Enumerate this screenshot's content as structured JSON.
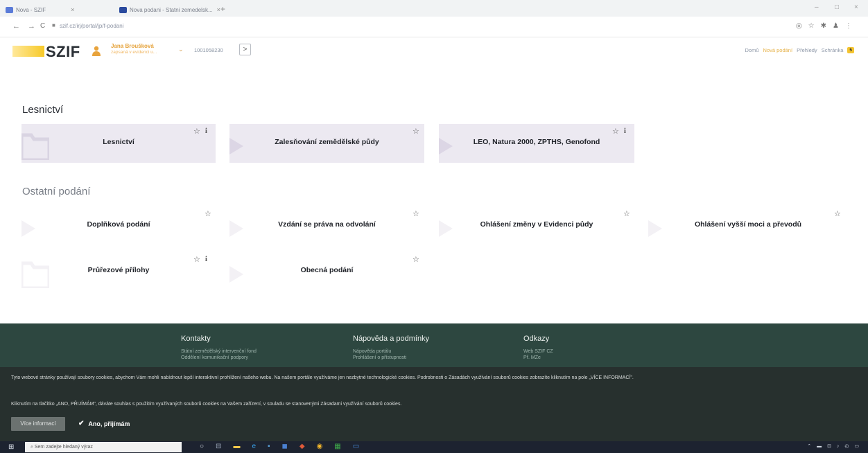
{
  "browser": {
    "tabs": [
      {
        "title": "Nova - SZIF",
        "icon_color": "#5a7bd8"
      },
      {
        "title": "Nova podani - Statni zemedelsk...",
        "icon_color": "#2a4a9e"
      }
    ],
    "new_tab": "+",
    "url": "szif.cz/irj/portal/jp/f-podani",
    "window_controls": [
      "–",
      "□",
      "×"
    ]
  },
  "header": {
    "logo": "SZIF",
    "user_name": "Jana Broušková",
    "user_org": "zapsaná v evidenci u...",
    "user_id": "1001058230",
    "next_btn": ">",
    "nav": {
      "home": "Domů",
      "new": "Nová podání",
      "overview": "Přehledy",
      "inbox": "Schránka",
      "badge": "5"
    }
  },
  "sections": [
    {
      "title": "Lesnictví",
      "cards": [
        {
          "label": "Lesnictví",
          "info": true
        },
        {
          "label": "Zalesňování zemědělské půdy",
          "info": false
        },
        {
          "label": "LEO, Natura 2000, ZPTHS, Genofond",
          "info": true
        }
      ]
    },
    {
      "title": "Ostatní podání",
      "cards": [
        {
          "label": "Doplňková podání",
          "info": false
        },
        {
          "label": "Vzdání se práva na odvolání",
          "info": false
        },
        {
          "label": "Ohlášení změny v Evidenci půdy",
          "info": false
        },
        {
          "label": "Ohlášení vyšší moci a převodů",
          "info": false
        },
        {
          "label": "Průřezové přílohy",
          "info": true
        },
        {
          "label": "Obecná podání",
          "info": false
        }
      ]
    }
  ],
  "footer": {
    "contacts": {
      "title": "Kontakty",
      "links": [
        "Státní zemědělský intervenční fond",
        "Oddělení komunikační podpory"
      ]
    },
    "help": {
      "title": "Nápověda a podmínky",
      "links": [
        "Nápověda portálu",
        "Prohlášení o přístupnosti"
      ]
    },
    "links": {
      "title": "Odkazy",
      "links": [
        "Web SZIF CZ",
        "Př. MZe"
      ]
    }
  },
  "cookie": {
    "text1": "Tyto webové stránky používají soubory cookies, abychom Vám mohli nabídnout lepší interaktivní prohlížení našeho webu. Na našem portále využíváme jen nezbytné technologické cookies. Podrobnosti o Zásadách využívání souborů cookies zobrazíte kliknutím na pole „VÍCE INFORMACÍ\".",
    "text2": "Kliknutím na tlačítko „ANO, PŘIJÍMÁM\", dáváte souhlas s použitím využívaných souborů cookies na Vašem zařízení, v souladu se stanovenými Zásadami využívání souborů cookies.",
    "more_btn": "Více informací",
    "accept_btn": "Ano, přijímám"
  },
  "taskbar": {
    "search_placeholder": "Sem zadejte hledaný výraz"
  }
}
